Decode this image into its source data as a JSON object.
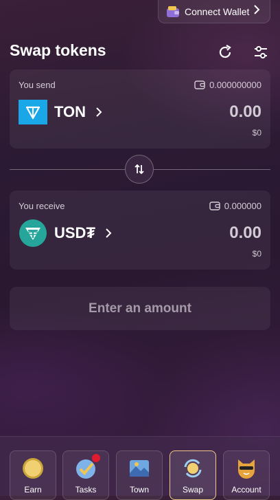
{
  "header": {
    "connect_wallet_label": "Connect Wallet"
  },
  "page": {
    "title": "Swap tokens"
  },
  "send": {
    "label": "You send",
    "balance": "0.000000000",
    "token": "TON",
    "amount": "0.00",
    "usd": "$0"
  },
  "receive": {
    "label": "You receive",
    "balance": "0.000000",
    "token": "USD₮",
    "amount": "0.00",
    "usd": "$0"
  },
  "action": {
    "label": "Enter an amount"
  },
  "nav": {
    "items": [
      {
        "label": "Earn",
        "icon": "coin-icon"
      },
      {
        "label": "Tasks",
        "icon": "tasks-icon"
      },
      {
        "label": "Town",
        "icon": "town-icon"
      },
      {
        "label": "Swap",
        "icon": "swap-icon"
      },
      {
        "label": "Account",
        "icon": "cat-avatar-icon"
      }
    ],
    "active": "Swap"
  },
  "colors": {
    "ton_blue": "#1aa7e8",
    "usdt_teal": "#26a69a",
    "active_border": "#f0c98a",
    "badge_red": "#e01b2f"
  }
}
